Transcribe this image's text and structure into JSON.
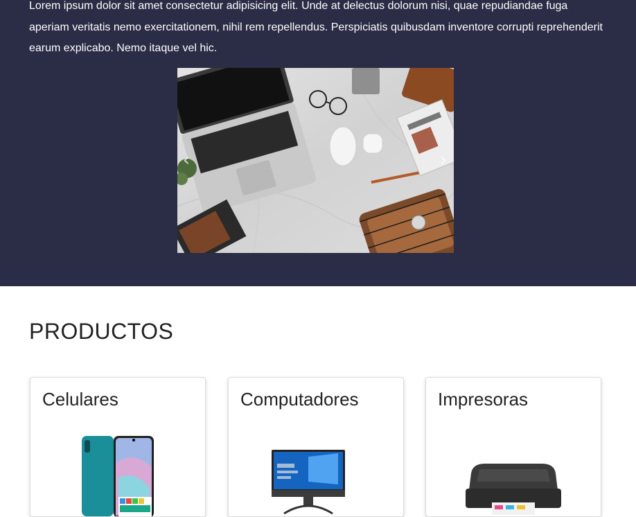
{
  "hero": {
    "text": "Lorem ipsum dolor sit amet consectetur adipisicing elit. Unde at delectus dolorum nisi, quae repudiandae fuga aperiam veritatis nemo exercitationem, nihil rem repellendus. Perspiciatis quibusdam inventore corrupti reprehenderit earum explicabo. Nemo itaque vel hic.",
    "carousel": {
      "prev_icon": "‹",
      "next_icon": "›"
    }
  },
  "products": {
    "title": "PRODUCTOS",
    "cards": [
      {
        "title": "Celulares",
        "icon": "phone-image"
      },
      {
        "title": "Computadores",
        "icon": "desktop-computer-image"
      },
      {
        "title": "Impresoras",
        "icon": "printer-image"
      }
    ]
  },
  "colors": {
    "hero_bg": "#2b2c45",
    "card_border": "#dcdcdc"
  }
}
